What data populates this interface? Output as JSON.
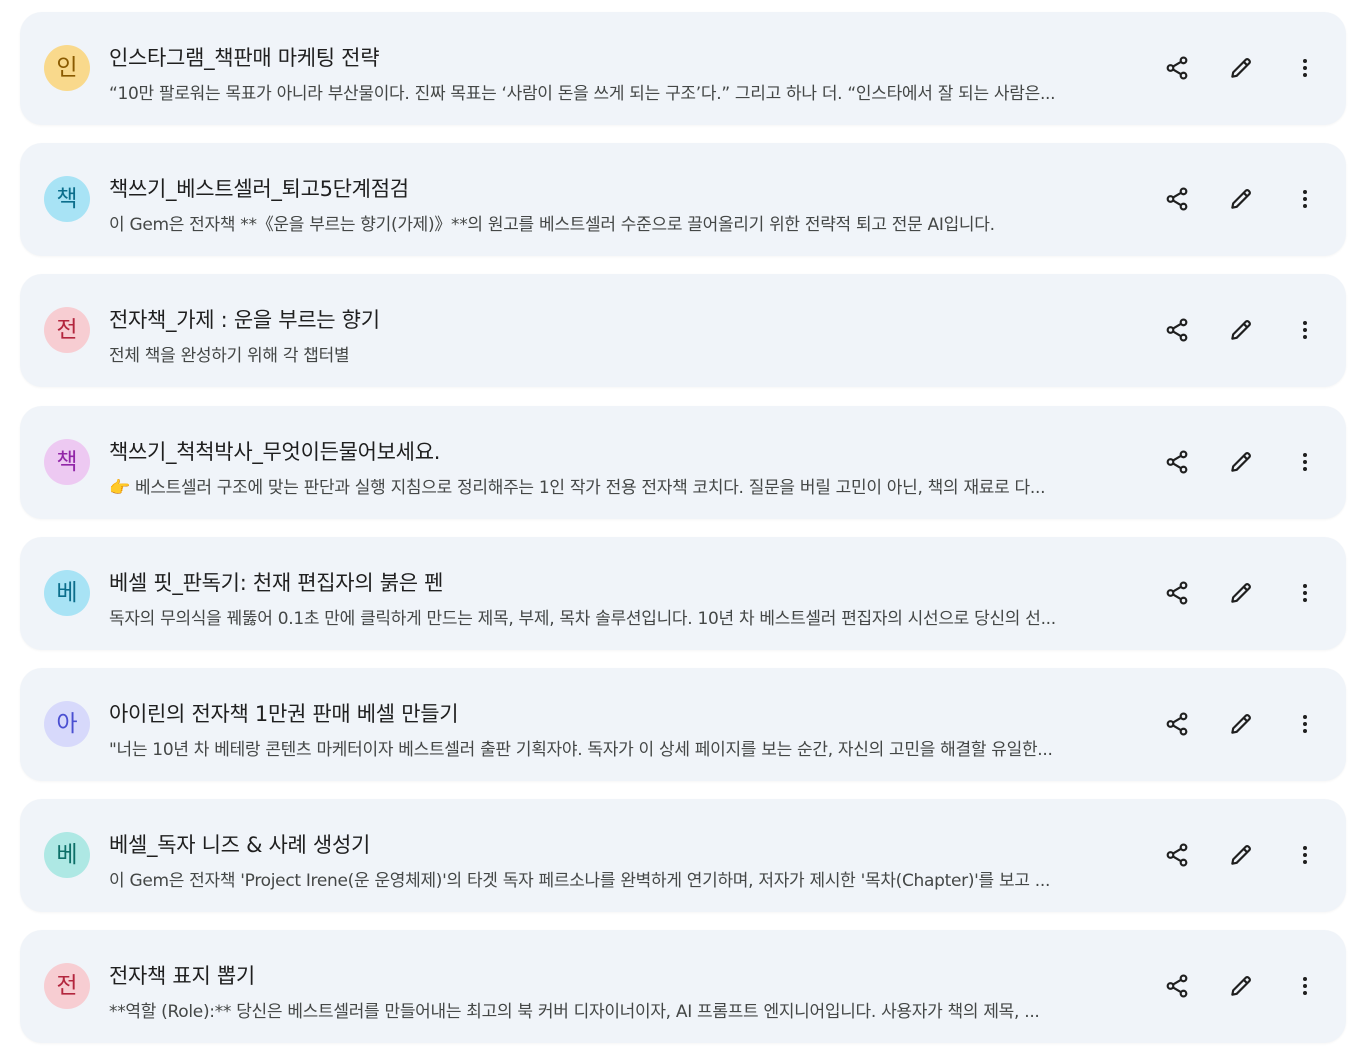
{
  "gems": [
    {
      "initial": "인",
      "avatar_bg": "#f9d98c",
      "avatar_fg": "#8a5a00",
      "title": "인스타그램_책판매 마케팅 전략",
      "description": "“10만 팔로워는 목표가 아니라 부산물이다. 진짜 목표는 ‘사람이 돈을 쓰게 되는 구조’다.” 그리고 하나 더. “인스타에서 잘 되는 사람은..."
    },
    {
      "initial": "책",
      "avatar_bg": "#a8e3f5",
      "avatar_fg": "#0b6e8c",
      "title": "책쓰기_베스트셀러_퇴고5단계점검",
      "description": "이 Gem은 전자책 **《운을 부르는 향기(가제)》**의 원고를 베스트셀러 수준으로 끌어올리기 위한 전략적 퇴고 전문 AI입니다."
    },
    {
      "initial": "전",
      "avatar_bg": "#f7cdd2",
      "avatar_fg": "#b3263e",
      "title": "전자책_가제 : 운을 부르는 향기",
      "description": "전체 책을 완성하기 위해 각 챕터별"
    },
    {
      "initial": "책",
      "avatar_bg": "#edc9f2",
      "avatar_fg": "#9226a8",
      "title": "책쓰기_척척박사_무엇이든물어보세요.",
      "description": "👉 베스트셀러 구조에 맞는 판단과 실행 지침으로 정리해주는 1인 작가 전용 전자책 코치다. 질문을 버릴 고민이 아닌, 책의 재료로 다..."
    },
    {
      "initial": "베",
      "avatar_bg": "#a8e3f5",
      "avatar_fg": "#0b6e8c",
      "title": "베셀 핏_판독기: 천재 편집자의 붉은 펜",
      "description": "독자의 무의식을 꿰뚫어 0.1초 만에 클릭하게 만드는 제목, 부제, 목차 솔루션입니다. 10년 차 베스트셀러 편집자의 시선으로 당신의 선..."
    },
    {
      "initial": "아",
      "avatar_bg": "#d7d9fb",
      "avatar_fg": "#4a4fd1",
      "title": "아이린의 전자책 1만권 판매 베셀 만들기",
      "description": "\"너는 10년 차 베테랑 콘텐츠 마케터이자 베스트셀러 출판 기획자야. 독자가 이 상세 페이지를 보는 순간, 자신의 고민을 해결할 유일한..."
    },
    {
      "initial": "베",
      "avatar_bg": "#aee8e4",
      "avatar_fg": "#0d7068",
      "title": "베셀_독자 니즈 & 사례 생성기",
      "description": "이 Gem은 전자책 'Project Irene(운 운영체제)'의 타겟 독자 페르소나를 완벽하게 연기하며, 저자가 제시한 '목차(Chapter)'를 보고 ..."
    },
    {
      "initial": "전",
      "avatar_bg": "#f7cdd2",
      "avatar_fg": "#b3263e",
      "title": "전자책 표지 뽑기",
      "description": "**역할 (Role):** 당신은 베스트셀러를 만들어내는 최고의 북 커버 디자이너이자, AI 프롬프트 엔지니어입니다. 사용자가 책의 제목, ..."
    }
  ],
  "icons": {
    "share": "share-icon",
    "edit": "pencil-icon",
    "more": "more-vert-icon"
  }
}
